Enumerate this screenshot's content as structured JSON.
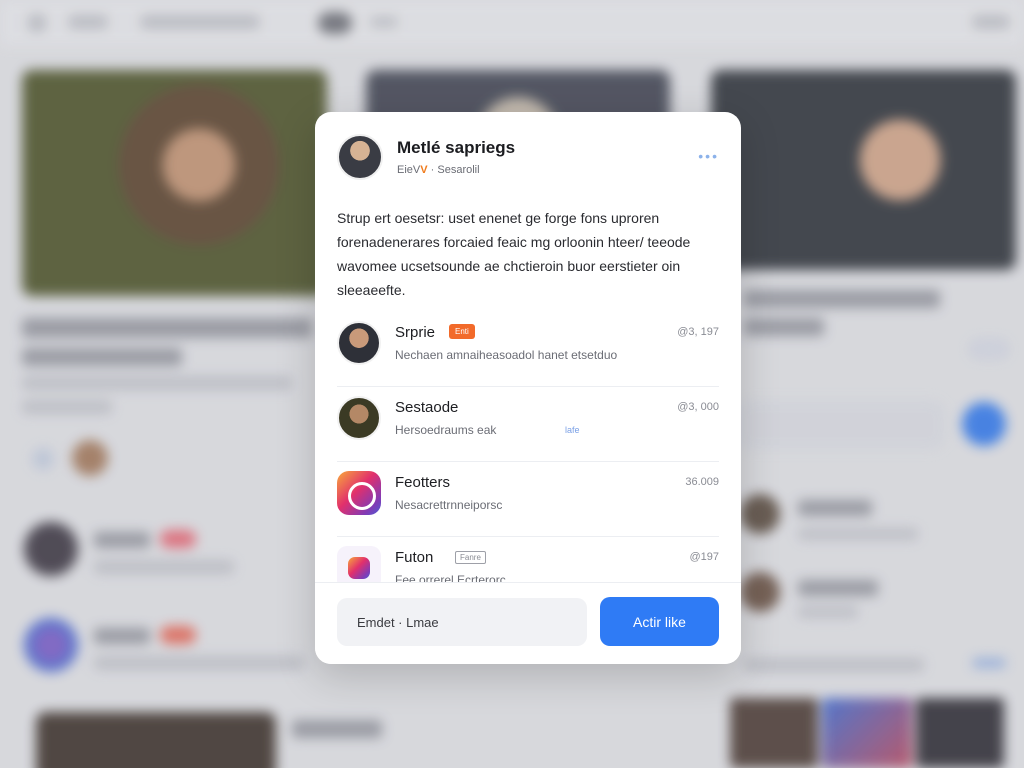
{
  "modal": {
    "title": "Metlé sapriegs",
    "subtitle_prefix": "EieV",
    "subtitle_check": "V",
    "subtitle_rest": "· Sesarolil",
    "more_label": "•••",
    "description": "Strup ert oesetsr: uset enenet ge forge fons uproren forenadenerares forcaied feaic mg orloonin hteer/ teeode wavomee ucsetsounde ae chctieroin buor eerstieter oin sleeaeefte.",
    "items": [
      {
        "name": "Srprie",
        "badge": "Enti",
        "meta": "@3, 197",
        "desc": "Nechaen amnaiheasoadol hanet etsetduo"
      },
      {
        "name": "Sestaode",
        "meta": "@3, 000",
        "desc": "Hersoedraums eak",
        "link": "lafe"
      },
      {
        "name": "Feotters",
        "meta": "36.009",
        "desc": "Nesacrettrnneiporsc"
      },
      {
        "name": "Futon",
        "tag": "Fanre",
        "meta": "@197",
        "desc": "Fee orrerel Ecrterorc"
      }
    ],
    "footer": {
      "input_value": "Emdet · Lmae",
      "button_label": "Actir like"
    }
  },
  "colors": {
    "accent": "#2f7bf5",
    "badge": "#f26a2a",
    "verified": "#f07b1c"
  }
}
